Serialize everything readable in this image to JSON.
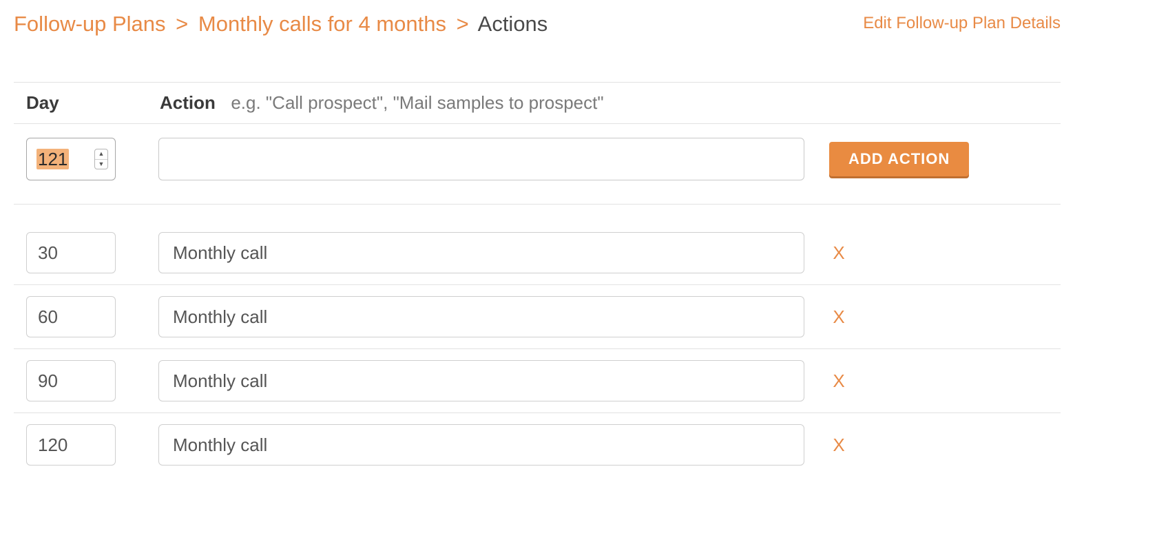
{
  "breadcrumb": {
    "root": "Follow-up Plans",
    "plan": "Monthly calls for 4 months",
    "current": "Actions",
    "separator": ">"
  },
  "edit_link": "Edit Follow-up Plan Details",
  "headers": {
    "day": "Day",
    "action": "Action",
    "hint": "e.g. \"Call prospect\", \"Mail samples to prospect\""
  },
  "add_row": {
    "day_value": "121",
    "action_value": "",
    "button_label": "ADD ACTION"
  },
  "rows": [
    {
      "day": "30",
      "action": "Monthly call",
      "delete_label": "X"
    },
    {
      "day": "60",
      "action": "Monthly call",
      "delete_label": "X"
    },
    {
      "day": "90",
      "action": "Monthly call",
      "delete_label": "X"
    },
    {
      "day": "120",
      "action": "Monthly call",
      "delete_label": "X"
    }
  ],
  "icons": {
    "chevron_up": "▲",
    "chevron_down": "▼"
  }
}
